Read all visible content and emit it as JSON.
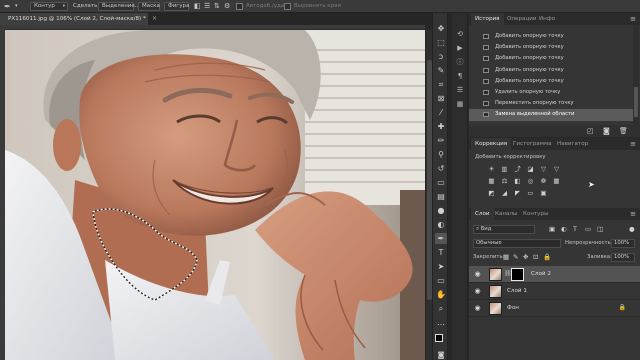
{
  "options_bar": {
    "tool_icon": "pen-icon",
    "mode": "Контур",
    "make_label": "Сделать:",
    "selection_btn": "Выделение...",
    "mask_btn": "Маска",
    "shape_btn": "Фигура",
    "auto_add_label": "Автодоб./удал.",
    "align_edges_label": "Выровнять края"
  },
  "document": {
    "tab_title": "PX116011.jpg @ 106% (Слой 2, Слой-маска/8) *",
    "close_glyph": "×"
  },
  "toolbar": {
    "tools": [
      "move-icon",
      "marquee-icon",
      "lasso-icon",
      "quick-select-icon",
      "crop-icon",
      "frame-icon",
      "eyedropper-icon",
      "spot-heal-icon",
      "brush-icon",
      "clone-stamp-icon",
      "history-brush-icon",
      "eraser-icon",
      "gradient-icon",
      "blur-icon",
      "dodge-icon",
      "pen-icon",
      "type-icon",
      "path-select-icon",
      "rectangle-icon",
      "hand-icon",
      "zoom-icon",
      "more-tools-icon"
    ],
    "colors": {
      "foreground": "#000000",
      "background": "#ffffff"
    }
  },
  "history": {
    "tabs": [
      "История",
      "Операции",
      "Инфо"
    ],
    "items": [
      "Добавить опорную точку",
      "Добавить опорную точку",
      "Добавить опорную точку",
      "Добавить опорную точку",
      "Добавить опорную точку",
      "Удалить опорную точку",
      "Переместить опорную точку",
      "Замена выделенной области"
    ],
    "selected_index": 7
  },
  "adjustments": {
    "tabs": [
      "Коррекция",
      "Гистограмма",
      "Навигатор"
    ],
    "prompt": "Добавить корректировку",
    "row1": [
      "brightness-icon",
      "levels-icon",
      "curves-icon",
      "exposure-icon",
      "vibrance-icon",
      "triangle-icon"
    ],
    "row2": [
      "hue-icon",
      "balance-icon",
      "bw-icon",
      "photo-filter-icon",
      "channel-mixer-icon",
      "lookup-icon"
    ],
    "row3": [
      "invert-icon",
      "posterize-icon",
      "threshold-icon",
      "gradient-map-icon",
      "selective-color-icon"
    ]
  },
  "layers": {
    "tabs": [
      "Слои",
      "Каналы",
      "Контуры"
    ],
    "filter": "Вид",
    "blend_mode": "Обычные",
    "opacity_label": "Непрозрачность:",
    "opacity_value": "100%",
    "lock_label": "Закрепить:",
    "fill_label": "Заливка:",
    "fill_value": "100%",
    "items": [
      {
        "name": "Слой 2",
        "selected": true,
        "has_mask": true
      },
      {
        "name": "Слой 1",
        "selected": false,
        "has_mask": false
      },
      {
        "name": "Фон",
        "selected": false,
        "has_mask": false
      }
    ]
  },
  "colors": {
    "app_bg": "#282828",
    "panel_bg": "#353535",
    "selected_row": "#5b5b5b"
  }
}
